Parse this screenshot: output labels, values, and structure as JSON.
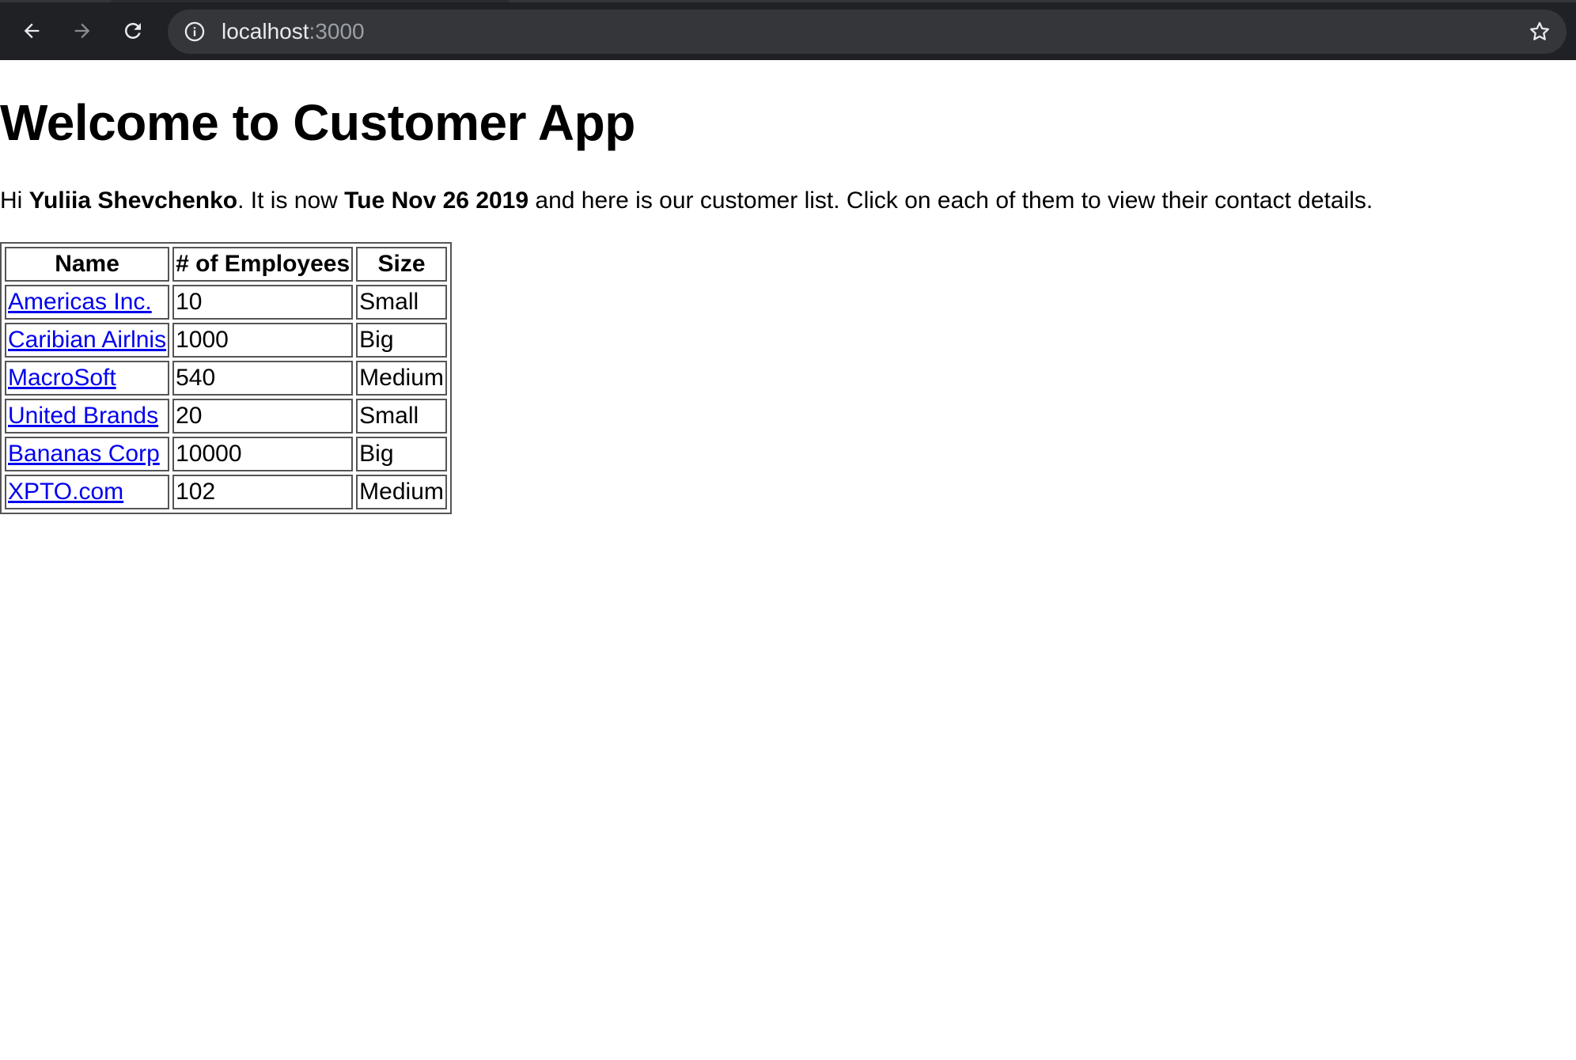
{
  "browser": {
    "url_host": "localhost",
    "url_port": ":3000",
    "back_icon": "arrow-left-icon",
    "forward_icon": "arrow-right-icon",
    "reload_icon": "reload-icon",
    "info_icon": "info-icon",
    "star_icon": "star-icon"
  },
  "page": {
    "title": "Welcome to Customer App",
    "intro": {
      "prefix": "Hi ",
      "user_name": "Yuliia Shevchenko",
      "middle": ". It is now ",
      "date": "Tue Nov 26 2019",
      "suffix": " and here is our customer list. Click on each of them to view their contact details."
    }
  },
  "table": {
    "headers": [
      "Name",
      "# of Employees",
      "Size"
    ],
    "rows": [
      {
        "name": "Americas Inc.",
        "employees": "10",
        "size": "Small"
      },
      {
        "name": "Caribian Airlnis",
        "employees": "1000",
        "size": "Big"
      },
      {
        "name": "MacroSoft",
        "employees": "540",
        "size": "Medium"
      },
      {
        "name": "United Brands",
        "employees": "20",
        "size": "Small"
      },
      {
        "name": "Bananas Corp",
        "employees": "10000",
        "size": "Big"
      },
      {
        "name": "XPTO.com",
        "employees": "102",
        "size": "Medium"
      }
    ]
  },
  "colors": {
    "chrome_bg": "#202124",
    "omnibox_bg": "#35363a",
    "link": "#0000ee"
  }
}
